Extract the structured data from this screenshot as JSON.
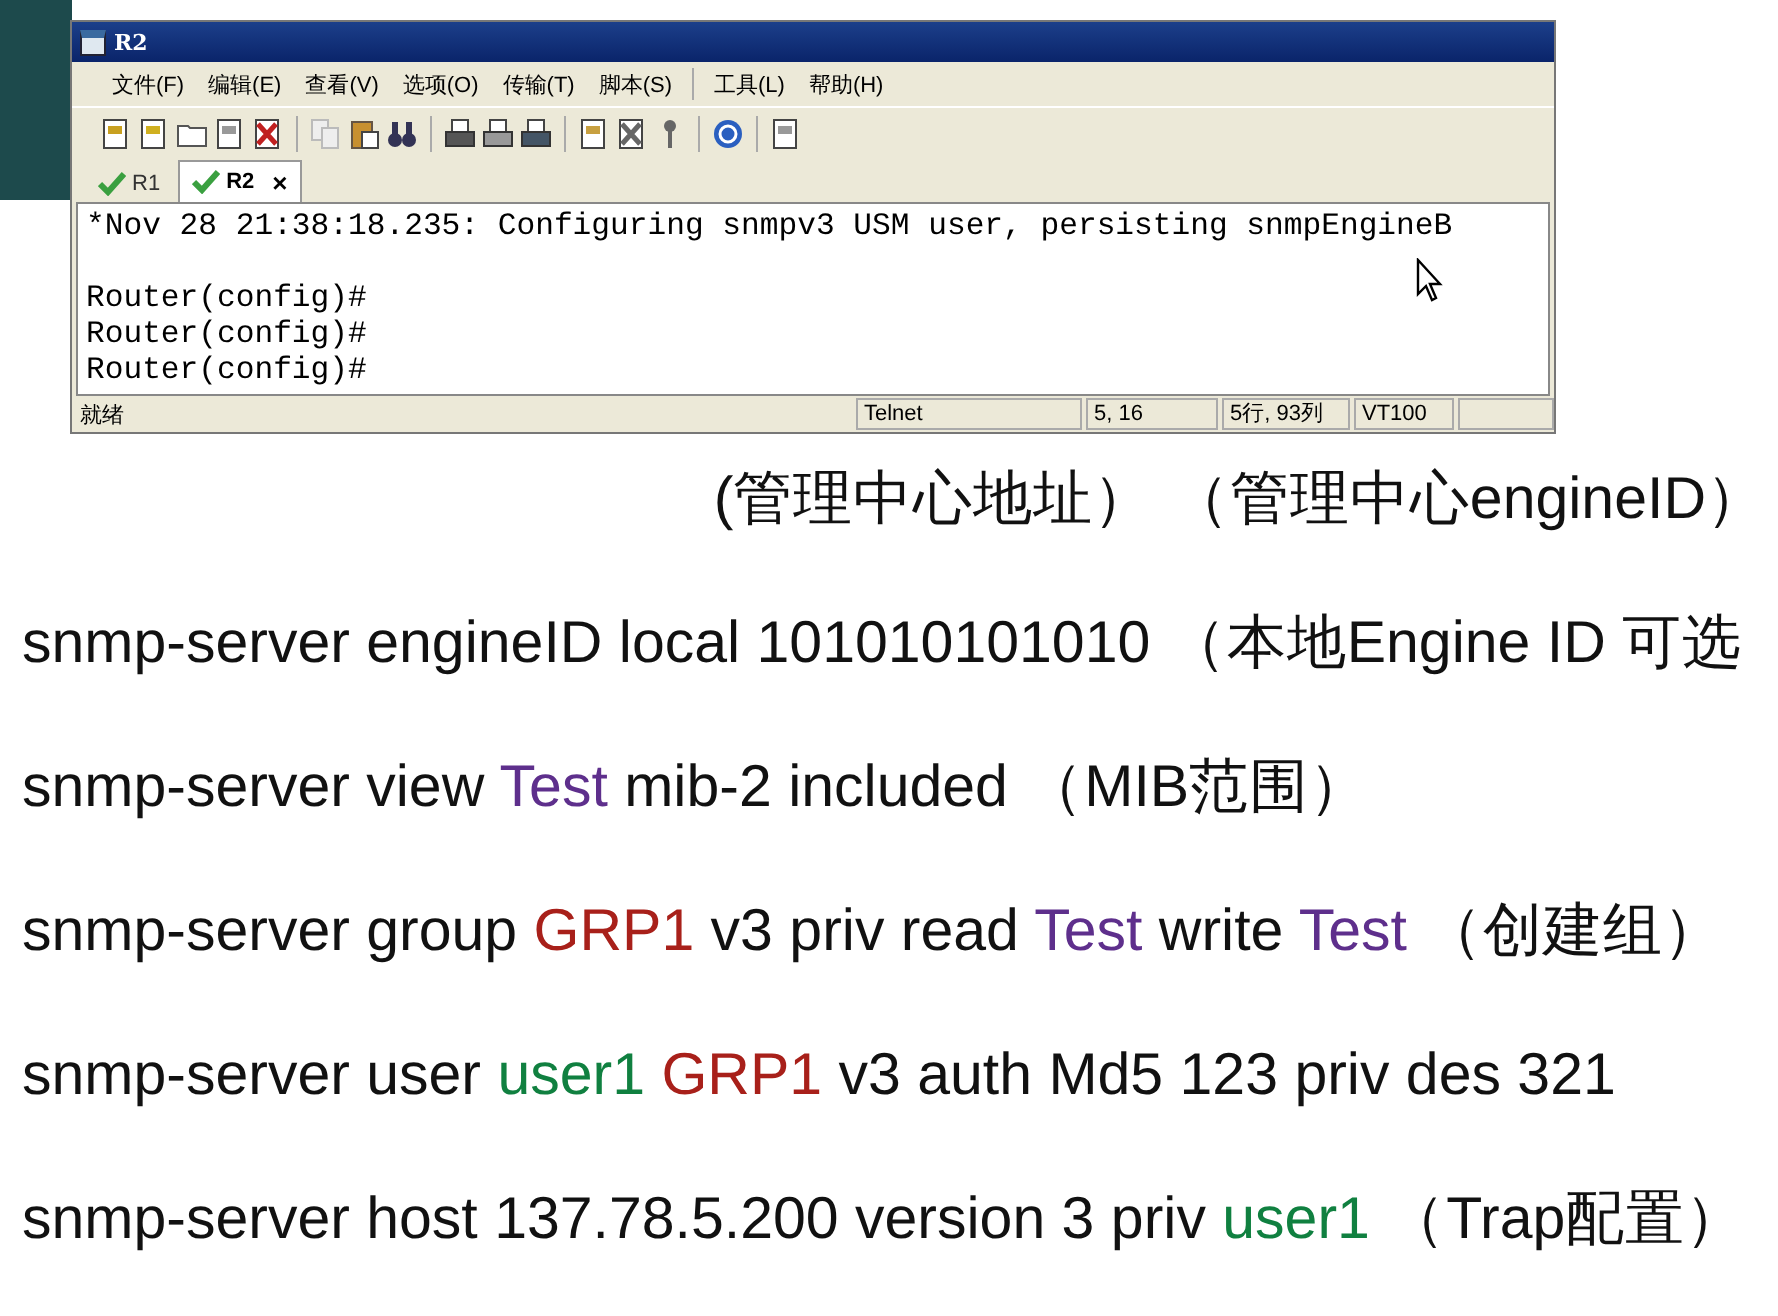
{
  "slide": {
    "lines": [
      {
        "kind": "note",
        "segments": [
          {
            "text": "(管理中心地址） （管理中心engineID）"
          }
        ]
      },
      {
        "kind": "code",
        "segments": [
          {
            "text": "snmp-server engineID local 101010101010 （本地Engine ID 可选"
          }
        ]
      },
      {
        "kind": "code",
        "segments": [
          {
            "text": "snmp-server view "
          },
          {
            "text": "Test",
            "color": "#5e2f8c"
          },
          {
            "text": " mib-2 included （MIB范围）"
          }
        ]
      },
      {
        "kind": "code",
        "segments": [
          {
            "text": "snmp-server group "
          },
          {
            "text": "GRP1",
            "color": "#a8201a"
          },
          {
            "text": " v3 priv read "
          },
          {
            "text": "Test",
            "color": "#5e2f8c"
          },
          {
            "text": " write "
          },
          {
            "text": "Test",
            "color": "#5e2f8c"
          },
          {
            "text": " （创建组）"
          }
        ]
      },
      {
        "kind": "code",
        "segments": [
          {
            "text": "snmp-server user "
          },
          {
            "text": "user1",
            "color": "#108040"
          },
          {
            "text": " GRP1",
            "color": "#a8201a"
          },
          {
            "text": " v3 auth Md5 123 priv des 321"
          }
        ]
      },
      {
        "kind": "code",
        "segments": [
          {
            "text": "snmp-server host 137.78.5.200 version 3 priv "
          },
          {
            "text": "user1",
            "color": "#108040"
          },
          {
            "text": " （Trap配置）"
          }
        ]
      }
    ]
  },
  "window": {
    "title": "R2",
    "menu": [
      "文件(F)",
      "编辑(E)",
      "查看(V)",
      "选项(O)",
      "传输(T)",
      "脚本(S)",
      "工具(L)",
      "帮助(H)"
    ],
    "tabs": [
      {
        "label": "R1",
        "selected": false
      },
      {
        "label": "R2",
        "selected": true,
        "close": "×"
      }
    ],
    "terminal": [
      {
        "lines": [
          "*Nov 28 21:38:18.235: Configuring snmpv3 USM user, persisting snmpEngineB"
        ]
      },
      {
        "lines": [
          "Router(config)#",
          "Router(config)#",
          "Router(config)#"
        ]
      }
    ],
    "status_bar": {
      "message": "就绪",
      "cells": [
        "Telnet",
        "5, 16",
        "5行, 93列",
        "VT100"
      ]
    }
  }
}
